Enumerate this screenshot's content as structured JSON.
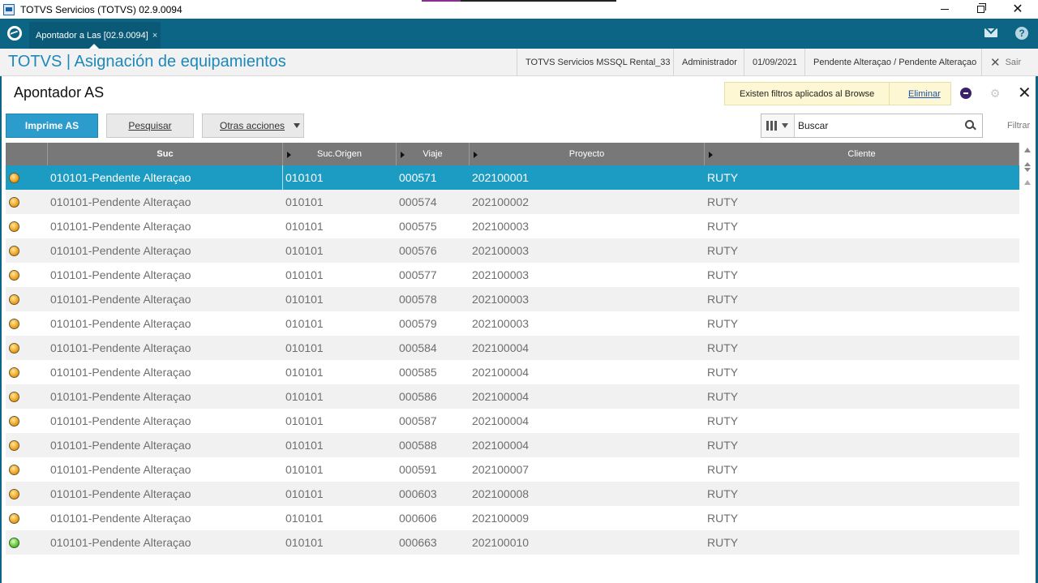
{
  "window": {
    "title": "TOTVS Servicios (TOTVS) 02.9.0094",
    "controls": [
      "minimize",
      "restore",
      "close"
    ]
  },
  "app_bar": {
    "tab_label": "Apontador a Las [02.9.0094]",
    "tab_close": "×",
    "help_glyph": "?"
  },
  "header": {
    "title": "TOTVS | Asignación de equipamientos",
    "company": "TOTVS Servicios MSSQL Rental_33",
    "user": "Administrador",
    "date": "01/09/2021",
    "branch_status": "Pendente Alteraçao / Pendente Alteraçao",
    "exit_label": "Sair",
    "exit_glyph": "✕"
  },
  "browse": {
    "title": "Apontador AS",
    "filter_notice": "Existen filtros aplicados al Browse",
    "filter_remove_label": "Eliminar",
    "close_glyph": "✕",
    "gear_glyph": "⚙"
  },
  "toolbar": {
    "primary_label": "Imprime AS",
    "pesquisar_label": "Pesquisar",
    "otras_label": "Otras acciones",
    "search_value": "Buscar",
    "filter_label": "Filtrar"
  },
  "grid": {
    "columns": [
      "Suc",
      "Suc.Origen",
      "Viaje",
      "Proyecto",
      "Cliente"
    ],
    "rows": [
      {
        "status": "orange",
        "suc": "010101-Pendente Alteraçao",
        "origen": "010101",
        "viaje": "000571",
        "proyecto": "202100001",
        "cliente": "RUTY",
        "selected": true
      },
      {
        "status": "orange",
        "suc": "010101-Pendente Alteraçao",
        "origen": "010101",
        "viaje": "000574",
        "proyecto": "202100002",
        "cliente": "RUTY"
      },
      {
        "status": "orange",
        "suc": "010101-Pendente Alteraçao",
        "origen": "010101",
        "viaje": "000575",
        "proyecto": "202100003",
        "cliente": "RUTY"
      },
      {
        "status": "orange",
        "suc": "010101-Pendente Alteraçao",
        "origen": "010101",
        "viaje": "000576",
        "proyecto": "202100003",
        "cliente": "RUTY"
      },
      {
        "status": "orange",
        "suc": "010101-Pendente Alteraçao",
        "origen": "010101",
        "viaje": "000577",
        "proyecto": "202100003",
        "cliente": "RUTY"
      },
      {
        "status": "orange",
        "suc": "010101-Pendente Alteraçao",
        "origen": "010101",
        "viaje": "000578",
        "proyecto": "202100003",
        "cliente": "RUTY"
      },
      {
        "status": "orange",
        "suc": "010101-Pendente Alteraçao",
        "origen": "010101",
        "viaje": "000579",
        "proyecto": "202100003",
        "cliente": "RUTY"
      },
      {
        "status": "orange",
        "suc": "010101-Pendente Alteraçao",
        "origen": "010101",
        "viaje": "000584",
        "proyecto": "202100004",
        "cliente": "RUTY"
      },
      {
        "status": "orange",
        "suc": "010101-Pendente Alteraçao",
        "origen": "010101",
        "viaje": "000585",
        "proyecto": "202100004",
        "cliente": "RUTY"
      },
      {
        "status": "orange",
        "suc": "010101-Pendente Alteraçao",
        "origen": "010101",
        "viaje": "000586",
        "proyecto": "202100004",
        "cliente": "RUTY"
      },
      {
        "status": "orange",
        "suc": "010101-Pendente Alteraçao",
        "origen": "010101",
        "viaje": "000587",
        "proyecto": "202100004",
        "cliente": "RUTY"
      },
      {
        "status": "orange",
        "suc": "010101-Pendente Alteraçao",
        "origen": "010101",
        "viaje": "000588",
        "proyecto": "202100004",
        "cliente": "RUTY"
      },
      {
        "status": "orange",
        "suc": "010101-Pendente Alteraçao",
        "origen": "010101",
        "viaje": "000591",
        "proyecto": "202100007",
        "cliente": "RUTY"
      },
      {
        "status": "orange",
        "suc": "010101-Pendente Alteraçao",
        "origen": "010101",
        "viaje": "000603",
        "proyecto": "202100008",
        "cliente": "RUTY"
      },
      {
        "status": "orange",
        "suc": "010101-Pendente Alteraçao",
        "origen": "010101",
        "viaje": "000606",
        "proyecto": "202100009",
        "cliente": "RUTY"
      },
      {
        "status": "green",
        "suc": "010101-Pendente Alteraçao",
        "origen": "010101",
        "viaje": "000663",
        "proyecto": "202100010",
        "cliente": "RUTY"
      }
    ]
  },
  "colors": {
    "brand_bar": "#0c6585",
    "accent": "#1e88b8",
    "selected_row": "#1d9cc3",
    "primary_button": "#2b9ccc",
    "filter_notice_bg": "#fdf8d3"
  }
}
